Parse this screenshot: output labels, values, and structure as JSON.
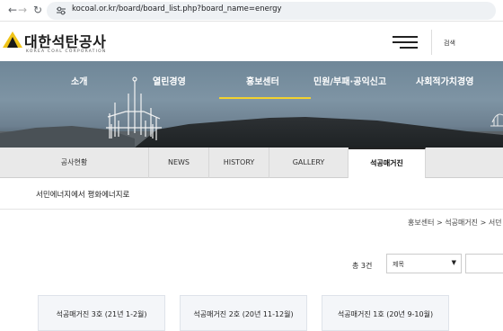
{
  "browser": {
    "url": "kocoal.or.kr/board/board_list.php?board_name=energy"
  },
  "header": {
    "logo_korean": "대한석탄공사",
    "logo_english": "KOREA COAL CORPORATION",
    "search_label": "검색"
  },
  "gnb": {
    "items": [
      "소개",
      "열린경영",
      "홍보센터",
      "민원/부패·공익신고",
      "사회적가치경영"
    ],
    "active": "홍보센터",
    "active_color": "#f2d22e"
  },
  "subtabs": {
    "items": [
      "공사현황",
      "NEWS",
      "HISTORY",
      "GALLERY",
      "석공매거진"
    ],
    "active": "석공매거진"
  },
  "page": {
    "description": "서민에너지에서 평화에너지로",
    "breadcrumb": "홍보센터 > 석공매거진 > 서던"
  },
  "board": {
    "total": "총 3건",
    "search_field": "제목",
    "cards": [
      "석공매거진 3호 (21년 1-2월)",
      "석공매거진 2호 (20년 11-12월)",
      "석공매거진 1호 (20년 9-10월)"
    ]
  }
}
